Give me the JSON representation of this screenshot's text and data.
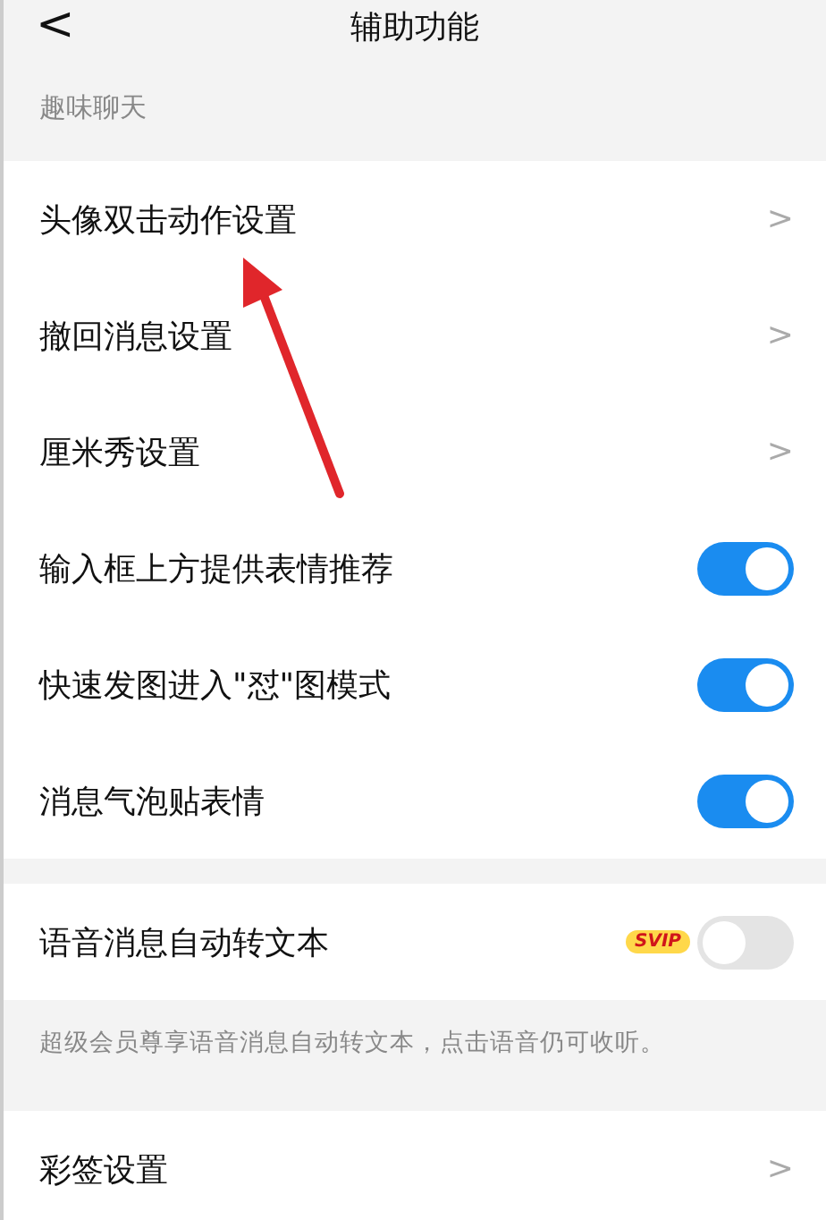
{
  "header": {
    "back": "<",
    "title": "辅助功能"
  },
  "sections": [
    {
      "label": "趣味聊天",
      "rows": [
        {
          "kind": "link",
          "label": "头像双击动作设置",
          "chevron": ">"
        },
        {
          "kind": "link",
          "label": "撤回消息设置",
          "chevron": ">"
        },
        {
          "kind": "link",
          "label": "厘米秀设置",
          "chevron": ">"
        },
        {
          "kind": "toggle",
          "label": "输入框上方提供表情推荐",
          "on": true
        },
        {
          "kind": "toggle",
          "label": "快速发图进入\"怼\"图模式",
          "on": true
        },
        {
          "kind": "toggle",
          "label": "消息气泡贴表情",
          "on": true
        }
      ]
    },
    {
      "rows": [
        {
          "kind": "toggle",
          "label": "语音消息自动转文本",
          "badge": "SVIP",
          "on": false
        }
      ],
      "note": "超级会员尊享语音消息自动转文本，点击语音仍可收听。"
    },
    {
      "rows": [
        {
          "kind": "link",
          "label": "彩签设置",
          "chevron": ">"
        }
      ]
    }
  ]
}
